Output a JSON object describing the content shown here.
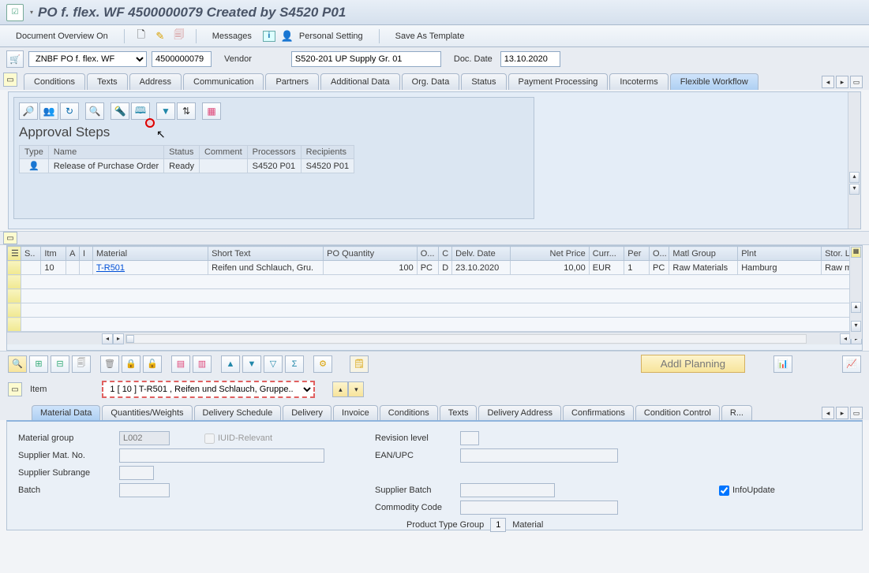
{
  "title": "PO f. flex. WF 4500000079 Created by S4520 P01",
  "toolbar": {
    "doc_overview": "Document Overview On",
    "messages": "Messages",
    "personal_setting": "Personal Setting",
    "save_template": "Save As Template"
  },
  "header": {
    "po_type": "ZNBF PO f. flex. WF",
    "po_number": "4500000079",
    "vendor_label": "Vendor",
    "vendor_value": "S520-201 UP Supply Gr. 01",
    "doc_date_label": "Doc. Date",
    "doc_date_value": "13.10.2020"
  },
  "header_tabs": [
    "Conditions",
    "Texts",
    "Address",
    "Communication",
    "Partners",
    "Additional Data",
    "Org. Data",
    "Status",
    "Payment Processing",
    "Incoterms",
    "Flexible Workflow"
  ],
  "header_tab_active": 10,
  "approval": {
    "title": "Approval Steps",
    "columns": [
      "Type",
      "Name",
      "Status",
      "Comment",
      "Processors",
      "Recipients"
    ],
    "rows": [
      {
        "type_icon": "👤",
        "name": "Release of Purchase Order",
        "status": "Ready",
        "comment": "",
        "processors": "S4520 P01",
        "recipients": "S4520 P01"
      }
    ]
  },
  "item_grid": {
    "columns": [
      "S..",
      "Itm",
      "A",
      "I",
      "Material",
      "Short Text",
      "PO Quantity",
      "O...",
      "C",
      "Delv. Date",
      "Net Price",
      "Curr...",
      "Per",
      "O...",
      "Matl Group",
      "Plnt",
      "Stor. L"
    ],
    "rows": [
      {
        "itm": "10",
        "material": "T-R501",
        "short_text": "Reifen und Schlauch, Gru.",
        "qty": "100",
        "oun": "PC",
        "c": "D",
        "delv": "23.10.2020",
        "price": "10,00",
        "curr": "EUR",
        "per": "1",
        "opu": "PC",
        "matlgrp": "Raw Materials",
        "plnt": "Hamburg",
        "stor": "Raw ma"
      }
    ]
  },
  "addl_planning": "Addl Planning",
  "item_detail": {
    "label": "Item",
    "combo": "1 [ 10 ] T-R501 , Reifen und Schlauch, Gruppe..",
    "tabs": [
      "Material Data",
      "Quantities/Weights",
      "Delivery Schedule",
      "Delivery",
      "Invoice",
      "Conditions",
      "Texts",
      "Delivery Address",
      "Confirmations",
      "Condition Control",
      "R..."
    ],
    "active": 0,
    "form": {
      "mat_group_label": "Material group",
      "mat_group": "L002",
      "iuid_label": "IUID-Relevant",
      "rev_level_label": "Revision level",
      "supplier_mat_label": "Supplier Mat. No.",
      "ean_label": "EAN/UPC",
      "supplier_sub_label": "Supplier Subrange",
      "batch_label": "Batch",
      "supp_batch_label": "Supplier Batch",
      "infoupdate_label": "InfoUpdate",
      "commodity_label": "Commodity Code",
      "prod_type_label": "Product Type Group",
      "prod_type_val": "1",
      "prod_type_txt": "Material"
    }
  }
}
